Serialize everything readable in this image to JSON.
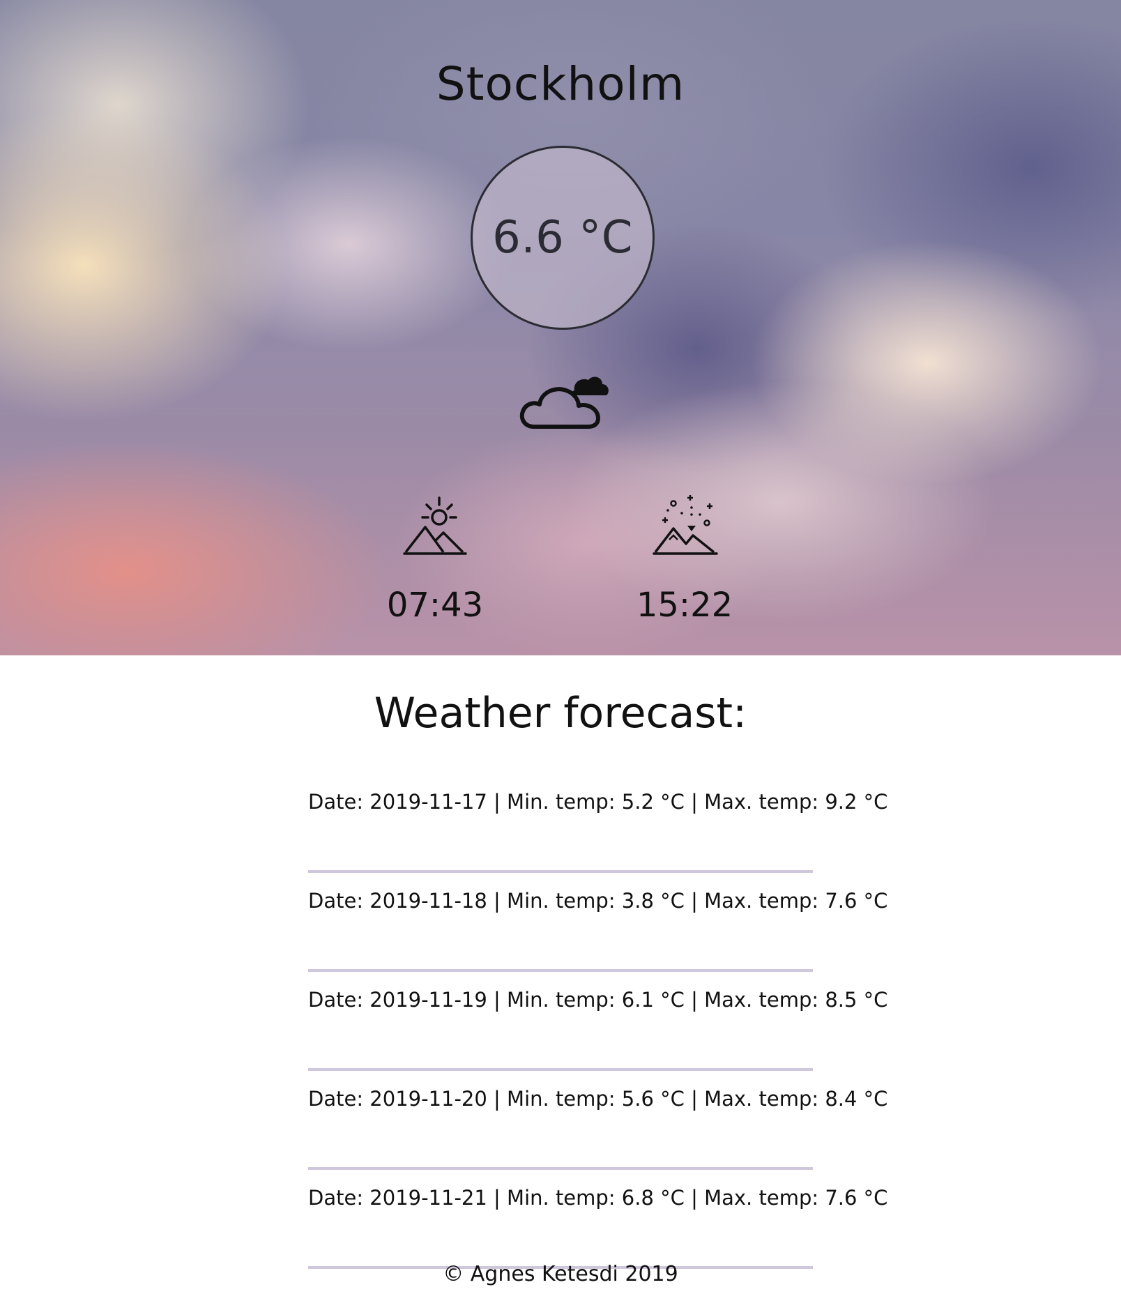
{
  "city": "Stockholm",
  "current": {
    "temperature": "6.6 °C",
    "condition_icon": "cloud-icon"
  },
  "sun": {
    "sunrise_icon": "sunrise-icon",
    "sunrise": "07:43",
    "sunset_icon": "sunset-icon",
    "sunset": "15:22"
  },
  "forecast": {
    "title": "Weather forecast:",
    "items": [
      "Date: 2019-11-17 | Min. temp: 5.2 °C | Max. temp: 9.2 °C",
      "Date: 2019-11-18 | Min. temp: 3.8 °C | Max. temp: 7.6 °C",
      "Date: 2019-11-19 | Min. temp: 6.1 °C | Max. temp: 8.5 °C",
      "Date: 2019-11-20 | Min. temp: 5.6 °C | Max. temp: 8.4 °C",
      "Date: 2019-11-21 | Min. temp: 6.8 °C | Max. temp: 7.6 °C"
    ]
  },
  "footer": "© Agnes Ketesdi 2019",
  "colors": {
    "text": "#111111",
    "circle_fill": "#beb4c8",
    "circle_border": "#2b2b33",
    "divider": "#cfc8dc"
  }
}
